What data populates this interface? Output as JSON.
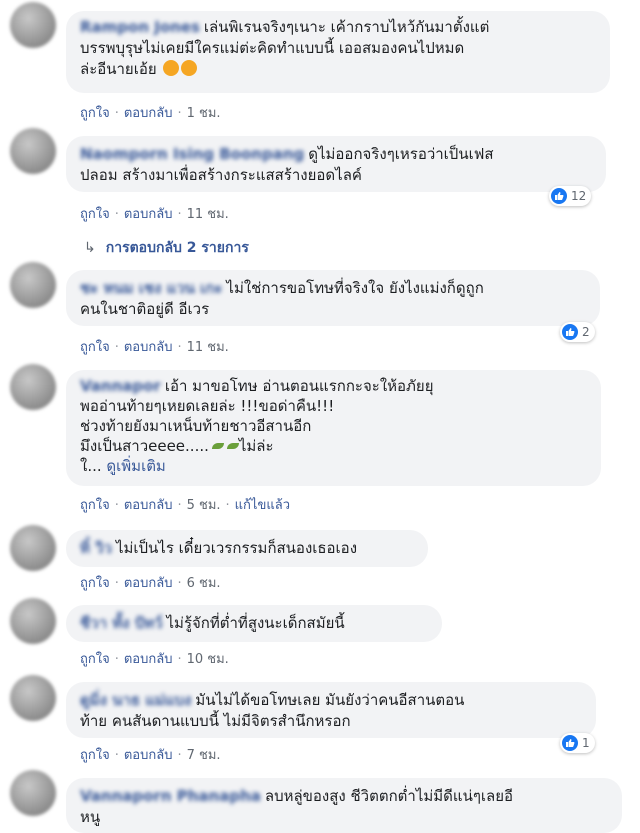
{
  "labels": {
    "like": "ถูกใจ",
    "reply": "ตอบกลับ",
    "see_more": "ดูเพิ่มเติม",
    "edited": "แก้ไขแล้ว"
  },
  "colors": {
    "link": "#385898",
    "bubble": "#f2f3f5",
    "meta": "#606770",
    "like_blue": "#1877f2"
  },
  "comments": [
    {
      "author": "Rampon Jones",
      "lines": [
        "เล่นพิเรนจริงๆเนาะ เค้ากราบไหว้กันมาตั้งแต่",
        "บรรพบุรุษไม่เคยมีใครแม่ต่ะคิดทำแบบนี้ เออสมองคนไปหมด",
        "ล่ะอีนายเอ้ย"
      ],
      "time": "1 ชม."
    },
    {
      "author": "Naomporn Ising Boonpang",
      "lines": [
        "ดูไม่ออกจริงๆเหรอว่าเป็นเฟส",
        "ปลอม สร้างมาเพื่อสร้างกระแสสร้างยอดไลค์"
      ],
      "time": "11 ชม.",
      "likes": "12",
      "replies": "การตอบกลับ 2 รายการ"
    },
    {
      "author": "ชะ หนม เชง แวน เกะ",
      "lines": [
        "ไม่ใช่การขอโทษที่จริงใจ ยังไงแม่งก็ดูถูก",
        "คนในชาติอยู่ดี อีเวร"
      ],
      "time": "11 ชม.",
      "likes": "2"
    },
    {
      "author": "Vannapor",
      "lines": [
        "เอ้า มาขอโทษ อ่านตอนแรกกะจะให้อภัยยุ",
        "พออ่านท้ายๆเหยดเลยล่ะ !!!ขอด่าคืน!!!",
        "ช่วงท้ายยังมาเหน็บท้ายชาวอีสานอีก",
        "มึงเป็นสาวeeee.....",
        "ไม่ล่ะ",
        "ใ..."
      ],
      "time": "5 ชม."
    },
    {
      "author": "ทิ๋ วิว",
      "lines": [
        "ไม่เป็นไร เดี๋ยวเวรกรรมก็สนองเธอเอง"
      ],
      "time": "6 ชม."
    },
    {
      "author": "ชีวา ทั้ง ปัทว์",
      "lines": [
        "ไม่รู้จักที่ต่ำที่สูงนะเด็กสมัยนี้"
      ],
      "time": "10 ชม."
    },
    {
      "author": "ดูมิ่ง นาธ แม่แบง",
      "lines": [
        "มันไม่ได้ขอโทษเลย มันยังว่าคนอีสานตอน",
        "ท้าย คนสันดานแบบนี้ ไม่มีจิตรสำนึกหรอก"
      ],
      "time": "7 ชม.",
      "likes": "1"
    },
    {
      "author": "Vannaporn Phanapha",
      "lines": [
        "ลบหลู่ของสูง ชีวิตตกต่ำไม่มีดีแน่ๆเลยอี",
        "หนู"
      ]
    }
  ]
}
